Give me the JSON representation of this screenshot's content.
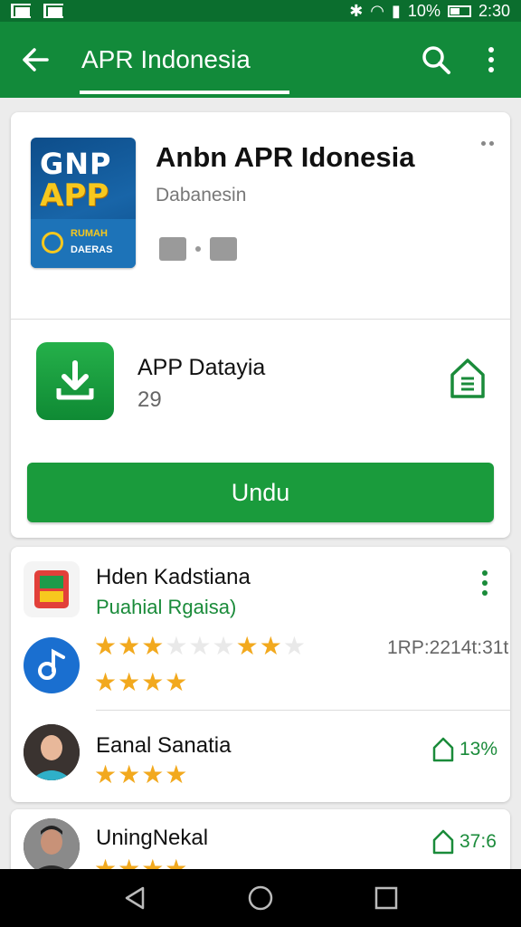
{
  "status_bar": {
    "battery": "10%",
    "time": "2:30"
  },
  "app_bar": {
    "title": "APR Indonesia"
  },
  "app_header": {
    "icon_line1": "GNP",
    "icon_line2": "APP",
    "icon_line3": "RUMAH",
    "icon_line4": "DAERAS",
    "title": "Anbn APR Idonesia",
    "developer": "Dabanesin"
  },
  "download_row": {
    "title": "APP Datayia",
    "count": "29"
  },
  "install_button": {
    "label": "Undu"
  },
  "reviews": [
    {
      "name": "Hden Kadstiana",
      "subtitle": "Puahial Rgaisa)",
      "meta": "1RP:2214t:31t"
    },
    {
      "name": "Eanal Sanatia",
      "stat": "13%"
    },
    {
      "name": "UningNekal",
      "stat": "37:6"
    }
  ],
  "colors": {
    "primary": "#128a3a",
    "status": "#0b6e2e",
    "button": "#1a9b3c",
    "star": "#f2a91e"
  },
  "icons": [
    "back-arrow-icon",
    "search-icon",
    "more-icon",
    "download-icon",
    "home-icon",
    "back-nav-icon",
    "home-nav-icon",
    "recents-nav-icon"
  ]
}
